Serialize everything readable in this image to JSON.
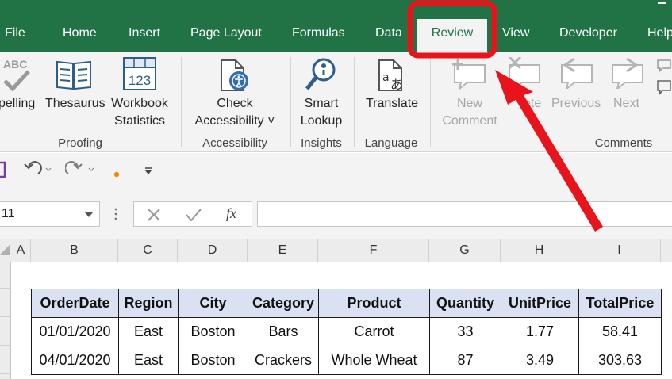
{
  "menu_tabs": [
    "File",
    "Home",
    "Insert",
    "Page Layout",
    "Formulas",
    "Data",
    "Review",
    "View",
    "Developer",
    "Help"
  ],
  "active_tab": "Review",
  "ribbon": {
    "proofing": {
      "spelling": "pelling",
      "thesaurus": "Thesaurus",
      "workbook_line1": "Workbook",
      "workbook_line2": "Statistics",
      "group": "Proofing",
      "spell_badge": "ABC",
      "stats_number": "123"
    },
    "accessibility": {
      "check_line1": "Check",
      "check_line2": "Accessibility ˅",
      "group": "Accessibility"
    },
    "insights": {
      "smart_line1": "Smart",
      "smart_line2": "Lookup",
      "group": "Insights"
    },
    "language": {
      "translate": "Translate",
      "group": "Language"
    },
    "comments": {
      "new_line1": "New",
      "new_line2": "Comment",
      "delete": "ete",
      "previous": "Previous",
      "next": "Next",
      "group": "Comments"
    }
  },
  "formula_bar": {
    "name_box": "11",
    "fx": "fx",
    "value": ""
  },
  "columns": [
    "A",
    "B",
    "C",
    "D",
    "E",
    "F",
    "G",
    "H",
    "I"
  ],
  "table": {
    "headers": [
      "OrderDate",
      "Region",
      "City",
      "Category",
      "Product",
      "Quantity",
      "UnitPrice",
      "TotalPrice"
    ],
    "rows": [
      [
        "01/01/2020",
        "East",
        "Boston",
        "Bars",
        "Carrot",
        "33",
        "1.77",
        "58.41"
      ],
      [
        "04/01/2020",
        "East",
        "Boston",
        "Crackers",
        "Whole Wheat",
        "87",
        "3.49",
        "303.63"
      ]
    ]
  },
  "colors": {
    "excel_green": "#217346",
    "ribbon_bg": "#f3f3f3",
    "header_fill": "#d9e1f2",
    "annotation_red": "#e8141b"
  }
}
